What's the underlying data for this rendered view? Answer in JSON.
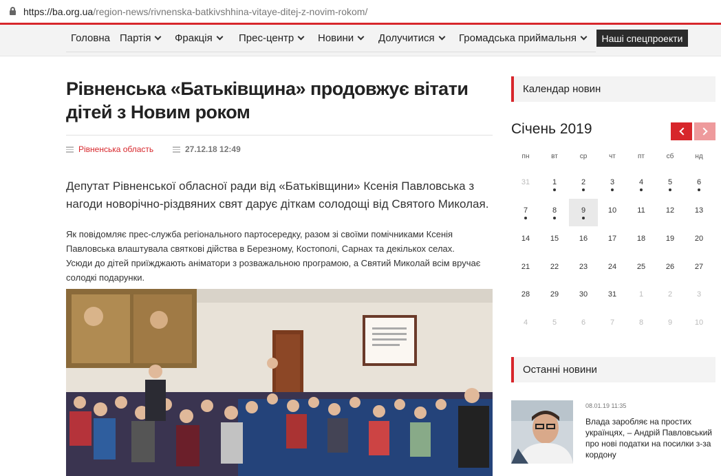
{
  "browser": {
    "url_domain": "https://ba.org.ua",
    "url_path": "/region-news/rivnenska-batkivshhina-vitaye-ditej-z-novim-rokom/"
  },
  "nav": {
    "items": [
      "Головна",
      "Партія",
      "Фракція",
      "Прес-центр",
      "Новини",
      "Долучитися",
      "Громадська приймальня"
    ],
    "special": "Наші спецпроекти"
  },
  "article": {
    "title": "Рівненська «Батьківщина» продовжує вітати дітей з Новим роком",
    "region": "Рівненська область",
    "date": "27.12.18 12:49",
    "lead": "Депутат Рівненської обласної ради від «Батьківщини» Ксенія Павловська з нагоди новорічно-різдвяних свят дарує діткам солодощі від Святого Миколая.",
    "body": "Як повідомляє прес-служба регіонального партосередку, разом зі своїми помічниками Ксенія Павловська влаштувала святкові дійства в Березному, Костополі, Сарнах та декількох селах. Усюди до дітей приїжджають аніматори з розважальною програмою, а Святий Миколай всім вручає солодкі подарунки."
  },
  "sidebar": {
    "calendar_title": "Календар новин",
    "month": "Січень 2019",
    "weekdays": [
      "пн",
      "вт",
      "ср",
      "чт",
      "пт",
      "сб",
      "нд"
    ],
    "weeks": [
      [
        "31",
        "1",
        "2",
        "3",
        "4",
        "5",
        "6"
      ],
      [
        "7",
        "8",
        "9",
        "10",
        "11",
        "12",
        "13"
      ],
      [
        "14",
        "15",
        "16",
        "17",
        "18",
        "19",
        "20"
      ],
      [
        "21",
        "22",
        "23",
        "24",
        "25",
        "26",
        "27"
      ],
      [
        "28",
        "29",
        "30",
        "31",
        "1",
        "2",
        "3"
      ],
      [
        "4",
        "5",
        "6",
        "7",
        "8",
        "9",
        "10"
      ]
    ],
    "latest_title": "Останні новини",
    "latest": {
      "date": "08.01.19 11:35",
      "title": "Влада заробляє на простих українцях, – Андрій Павловський про нові податки на посилки з-за кордону"
    }
  },
  "colors": {
    "accent": "#d7262b",
    "accent_light": "#ee9a9c",
    "dark": "#2b2b2b"
  }
}
